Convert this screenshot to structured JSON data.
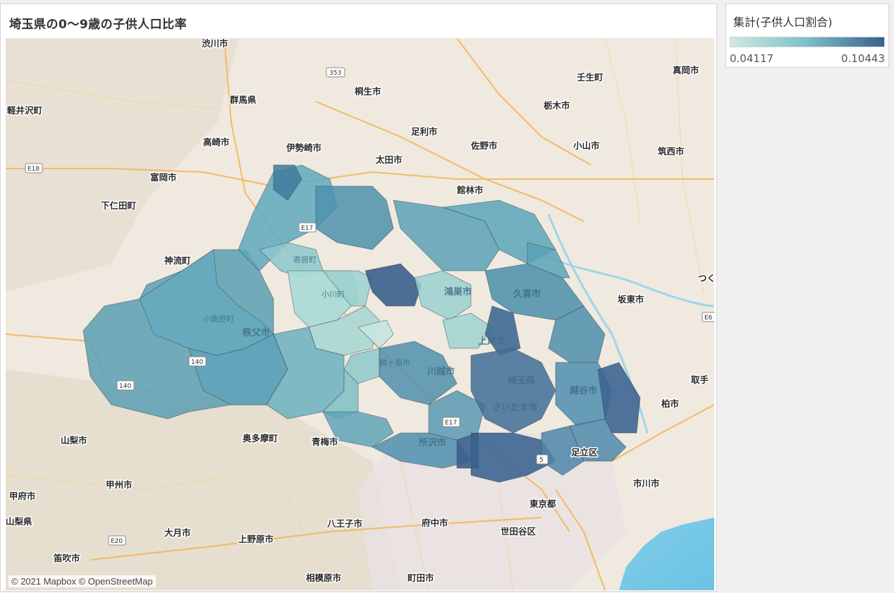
{
  "title": "埼玉県の0～9歳の子供人口比率",
  "legend": {
    "title": "集計(子供人口割合)",
    "min": "0.04117",
    "max": "0.10443",
    "color_low": "#cfe9e0",
    "color_high": "#3a5f8c"
  },
  "attribution": "© 2021 Mapbox © OpenStreetMap",
  "map": {
    "background_labels": [
      "渋川市",
      "群馬県",
      "桐生市",
      "壬生町",
      "真岡市",
      "軽井沢町",
      "足利市",
      "栃木市",
      "高崎市",
      "伊勢崎市",
      "太田市",
      "佐野市",
      "小山市",
      "筑西市",
      "富岡市",
      "館林市",
      "下仁田町",
      "神流町",
      "坂東市",
      "つく",
      "取手",
      "柏市",
      "山梨市",
      "奥多摩町",
      "青梅市",
      "足立区",
      "甲州市",
      "市川市",
      "甲府市",
      "東京都",
      "山梨県",
      "大月市",
      "八王子市",
      "府中市",
      "世田谷区",
      "上野原市",
      "笛吹市",
      "相模原市",
      "町田市"
    ],
    "overlay_labels": [
      "寄居町",
      "小川町",
      "小鹿野町",
      "秩父市",
      "鴻巣市",
      "久喜市",
      "上尾市",
      "鶴ヶ島市",
      "川越市",
      "埼玉県",
      "越谷市",
      "さいたま市",
      "所沢市"
    ],
    "road_shields": [
      "353",
      "E18",
      "E17",
      "140",
      "140",
      "E17",
      "5",
      "E6",
      "E20"
    ]
  }
}
